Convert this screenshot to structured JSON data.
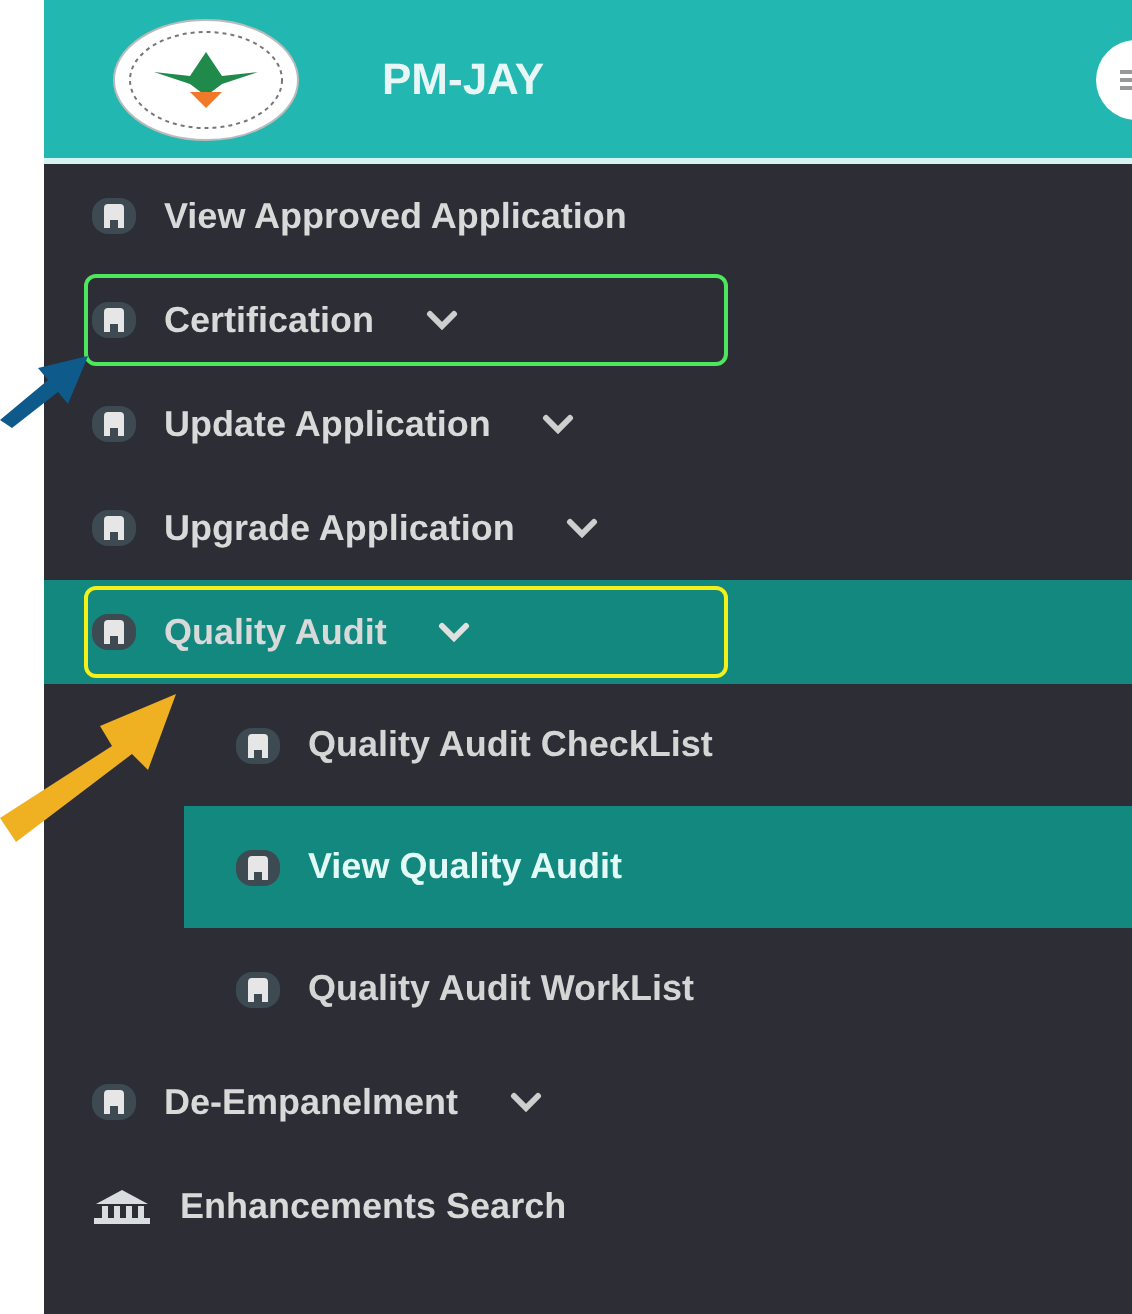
{
  "header": {
    "title": "PM-JAY"
  },
  "menu": [
    {
      "label": "View Approved Application",
      "kind": "link",
      "selected": false
    },
    {
      "label": "Certification",
      "kind": "group",
      "selected": false,
      "expanded": false,
      "annotation": {
        "frame": {
          "color": "#4ee65c"
        },
        "arrow": {
          "color": "#0e5a8a"
        }
      }
    },
    {
      "label": "Update Application",
      "kind": "group",
      "selected": false,
      "expanded": false
    },
    {
      "label": "Upgrade Application",
      "kind": "group",
      "selected": false,
      "expanded": false
    },
    {
      "label": "Quality Audit",
      "kind": "group",
      "selected": true,
      "expanded": true,
      "annotation": {
        "frame": {
          "color": "#f4f01a"
        },
        "arrow": {
          "color": "#efb022"
        }
      },
      "children": [
        {
          "label": "Quality Audit CheckList",
          "selected": false
        },
        {
          "label": "View Quality Audit",
          "selected": true
        },
        {
          "label": "Quality Audit WorkList",
          "selected": false
        }
      ]
    },
    {
      "label": "De-Empanelment",
      "kind": "group",
      "selected": false,
      "expanded": false
    },
    {
      "label": "Enhancements Search",
      "kind": "bank",
      "selected": false
    }
  ]
}
